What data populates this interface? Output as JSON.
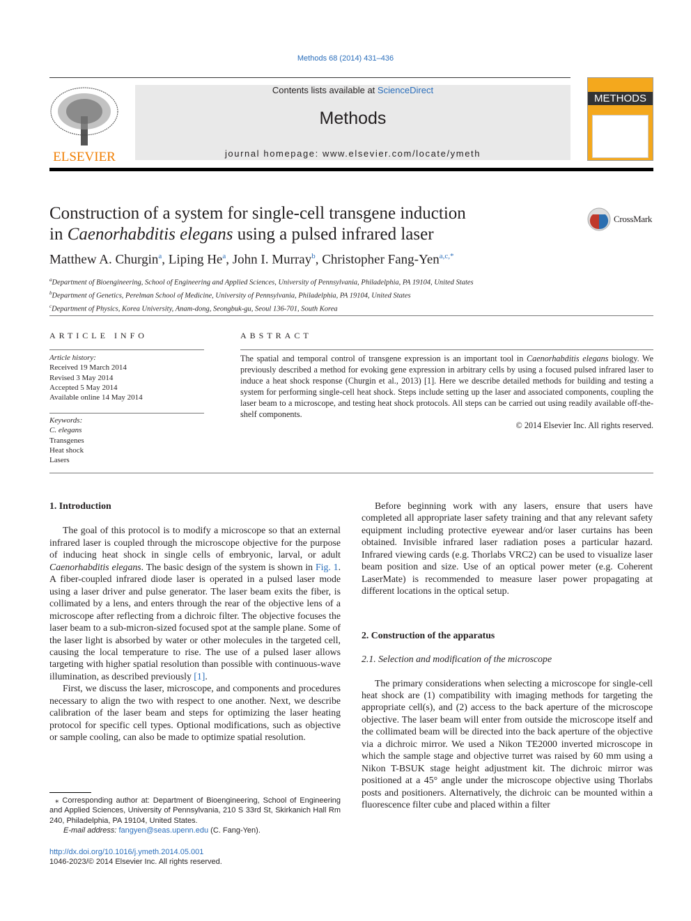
{
  "citation": "Methods 68 (2014) 431–436",
  "header": {
    "contents_prefix": "Contents lists available at ",
    "contents_link": "ScienceDirect",
    "journal": "Methods",
    "homepage": "journal homepage: www.elsevier.com/locate/ymeth",
    "publisher_logo": "ELSEVIER",
    "cover_title": "METHODS",
    "crossmark": "CrossMark"
  },
  "title_line1": "Construction of a system for single-cell transgene induction",
  "title_line2_pre": "in ",
  "title_line2_italic": "Caenorhabditis elegans",
  "title_line2_post": " using a pulsed infrared laser",
  "authors": [
    {
      "name": "Matthew A. Churgin",
      "sup": "a"
    },
    {
      "name": "Liping He",
      "sup": "a"
    },
    {
      "name": "John I. Murray",
      "sup": "b"
    },
    {
      "name": "Christopher Fang-Yen",
      "sup": "a,c,*"
    }
  ],
  "affiliations": [
    {
      "sup": "a",
      "text": "Department of Bioengineering, School of Engineering and Applied Sciences, University of Pennsylvania, Philadelphia, PA 19104, United States"
    },
    {
      "sup": "b",
      "text": "Department of Genetics, Perelman School of Medicine, University of Pennsylvania, Philadelphia, PA 19104, United States"
    },
    {
      "sup": "c",
      "text": "Department of Physics, Korea University, Anam-dong, Seongbuk-gu, Seoul 136-701, South Korea"
    }
  ],
  "article_info": {
    "heading": "ARTICLE INFO",
    "history_label": "Article history:",
    "history": [
      "Received 19 March 2014",
      "Revised 3 May 2014",
      "Accepted 5 May 2014",
      "Available online 14 May 2014"
    ],
    "keywords_label": "Keywords:",
    "keywords": [
      "C. elegans",
      "Transgenes",
      "Heat shock",
      "Lasers"
    ]
  },
  "abstract": {
    "heading": "ABSTRACT",
    "text_pre": "The spatial and temporal control of transgene expression is an important tool in ",
    "text_italic": "Caenorhabditis elegans",
    "text_post": " biology. We previously described a method for evoking gene expression in arbitrary cells by using a focused pulsed infrared laser to induce a heat shock response (Churgin et al., 2013) [1]. Here we describe detailed methods for building and testing a system for performing single-cell heat shock. Steps include setting up the laser and associated components, coupling the laser beam to a microscope, and testing heat shock protocols. All steps can be carried out using readily available off-the-shelf components.",
    "copyright": "© 2014 Elsevier Inc. All rights reserved."
  },
  "body": {
    "s1_heading": "1. Introduction",
    "p1_a": "The goal of this protocol is to modify a microscope so that an external infrared laser is coupled through the microscope objective for the purpose of inducing heat shock in single cells of embryonic, larval, or adult ",
    "p1_i": "Caenorhabditis elegans",
    "p1_b": ". The basic design of the system is shown in ",
    "p1_fig": "Fig. 1",
    "p1_c": ". A fiber-coupled infrared diode laser is operated in a pulsed laser mode using a laser driver and pulse generator. The laser beam exits the fiber, is collimated by a lens, and enters through the rear of the objective lens of a microscope after reflecting from a dichroic filter. The objective focuses the laser beam to a sub-micron-sized focused spot at the sample plane. Some of the laser light is absorbed by water or other molecules in the targeted cell, causing the local temperature to rise. The use of a pulsed laser allows targeting with higher spatial resolution than possible with continuous-wave illumination, as described previously ",
    "p1_ref": "[1]",
    "p1_d": ".",
    "p2": "First, we discuss the laser, microscope, and components and procedures necessary to align the two with respect to one another. Next, we describe calibration of the laser beam and steps for optimizing the laser heating protocol for specific cell types. Optional modifications, such as objective or sample cooling, can also be made to optimize spatial resolution.",
    "p3": "Before beginning work with any lasers, ensure that users have completed all appropriate laser safety training and that any relevant safety equipment including protective eyewear and/or laser curtains has been obtained. Invisible infrared laser radiation poses a particular hazard. Infrared viewing cards (e.g. Thorlabs VRC2) can be used to visualize laser beam position and size. Use of an optical power meter (e.g. Coherent LaserMate) is recommended to measure laser power propagating at different locations in the optical setup.",
    "s2_heading": "2. Construction of the apparatus",
    "s21_heading": "2.1. Selection and modification of the microscope",
    "p4": "The primary considerations when selecting a microscope for single-cell heat shock are (1) compatibility with imaging methods for targeting the appropriate cell(s), and (2) access to the back aperture of the microscope objective. The laser beam will enter from outside the microscope itself and the collimated beam will be directed into the back aperture of the objective via a dichroic mirror. We used a Nikon TE2000 inverted microscope in which the sample stage and objective turret was raised by 60 mm using a Nikon T-BSUK stage height adjustment kit. The dichroic mirror was positioned at a 45° angle under the microscope objective using Thorlabs posts and positioners. Alternatively, the dichroic can be mounted within a fluorescence filter cube and placed within a filter"
  },
  "footnote": {
    "corresponding": "⁎ Corresponding author at: Department of Bioengineering, School of Engineering and Applied Sciences, University of Pennsylvania, 210 S 33rd St, Skirkanich Hall Rm 240, Philadelphia, PA 19104, United States.",
    "email_label": "E-mail address: ",
    "email": "fangyen@seas.upenn.edu",
    "email_post": " (C. Fang-Yen).",
    "doi": "http://dx.doi.org/10.1016/j.ymeth.2014.05.001",
    "issn": "1046-2023/© 2014 Elsevier Inc. All rights reserved."
  },
  "colors": {
    "link": "#2a6ebb",
    "elsevier_orange": "#f07d00"
  }
}
